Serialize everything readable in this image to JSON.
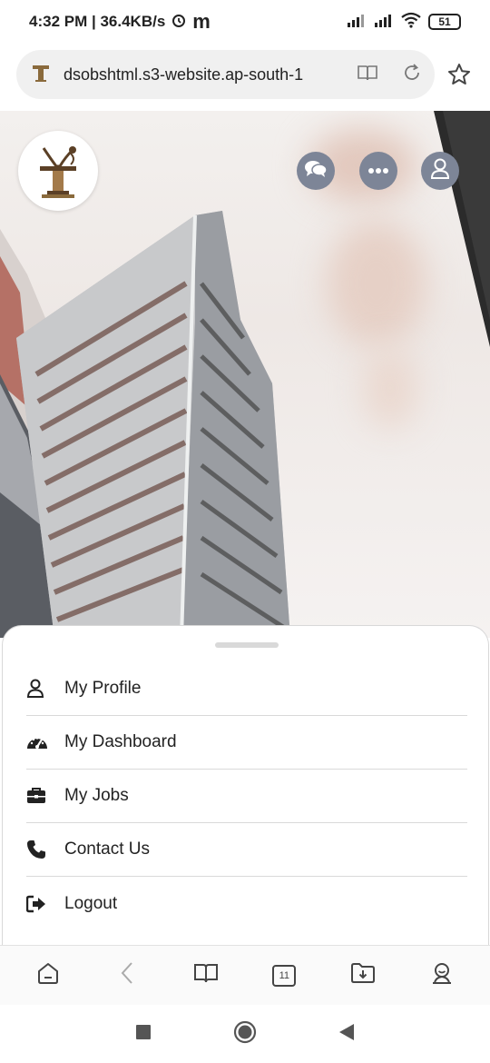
{
  "status_bar": {
    "time_speed": "4:32 PM | 36.4KB/s",
    "app_glyph": "m",
    "battery": "51"
  },
  "url_bar": {
    "url": "dsobshtml.s3-website.ap-south-1",
    "site_icon": "site-logo-icon",
    "reader_icon": "reader-mode-icon",
    "reload_icon": "reload-icon",
    "bookmark_icon": "star-icon"
  },
  "hero": {
    "logo_icon": "brand-logo-icon",
    "buttons": [
      {
        "icon": "chat-icon"
      },
      {
        "icon": "more-icon"
      },
      {
        "icon": "user-icon"
      }
    ]
  },
  "menu": {
    "items": [
      {
        "label": "My Profile",
        "icon": "user-outline-icon"
      },
      {
        "label": "My Dashboard",
        "icon": "dashboard-icon"
      },
      {
        "label": "My Jobs",
        "icon": "briefcase-icon"
      },
      {
        "label": "Contact Us",
        "icon": "phone-icon"
      },
      {
        "label": "Logout",
        "icon": "logout-icon"
      }
    ]
  },
  "toolbar": {
    "tabs_count": "11"
  },
  "colors": {
    "button_bg": "#7d8597",
    "sheet_bg": "#ffffff",
    "divider": "#d9d9d9"
  }
}
